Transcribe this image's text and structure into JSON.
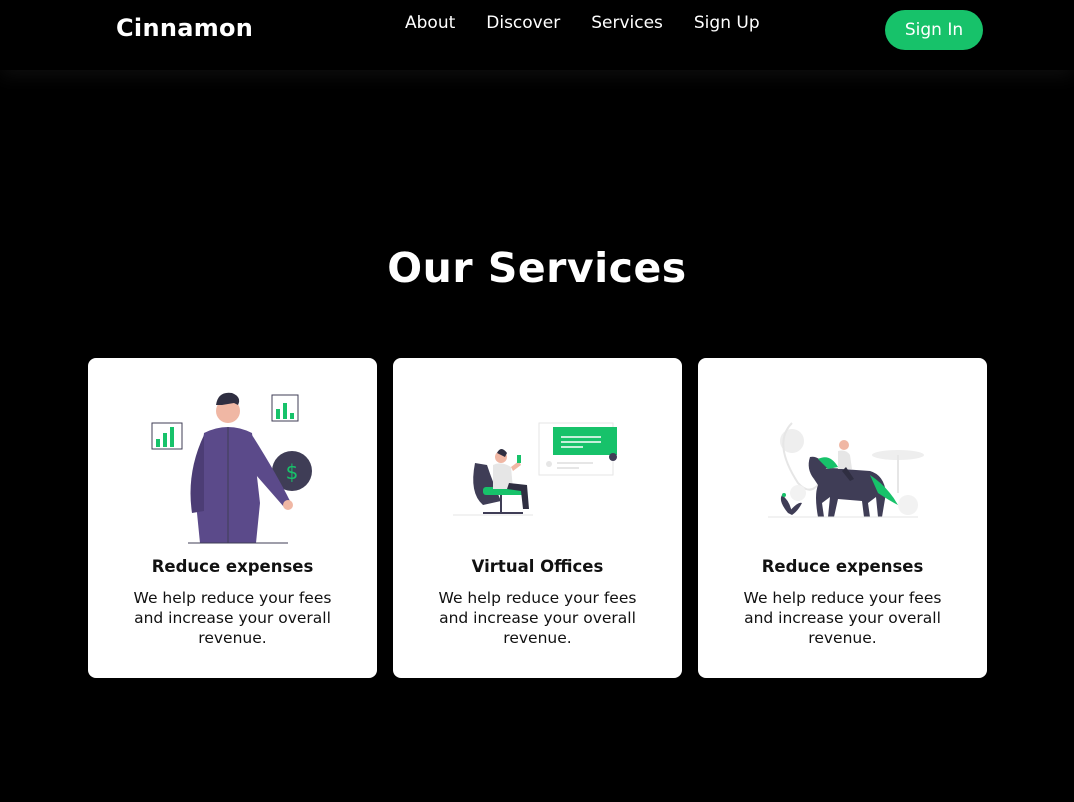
{
  "header": {
    "brand": "Cinnamon",
    "nav": [
      "About",
      "Discover",
      "Services",
      "Sign Up"
    ],
    "signin_label": "Sign In"
  },
  "services": {
    "title": "Our Services",
    "cards": [
      {
        "title": "Reduce expenses",
        "desc": "We help reduce your fees and increase your overall revenue.",
        "icon": "man-with-charts-illustration"
      },
      {
        "title": "Virtual Offices",
        "desc": "We help reduce your fees and increase your overall revenue.",
        "icon": "woman-at-desk-illustration"
      },
      {
        "title": "Reduce expenses",
        "desc": "We help reduce your fees and increase your overall revenue.",
        "icon": "horse-rider-illustration"
      }
    ]
  },
  "colors": {
    "accent": "#17c26a",
    "background": "#000000",
    "card": "#ffffff",
    "figure": "#5b4a8a",
    "dark": "#3f3d56"
  }
}
